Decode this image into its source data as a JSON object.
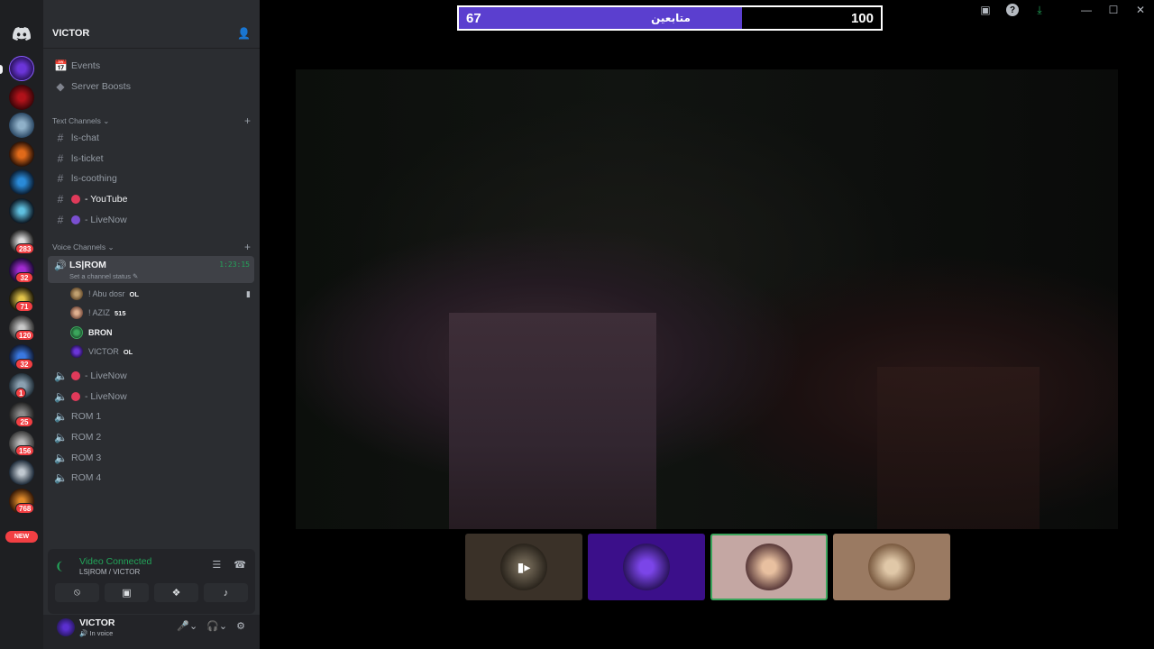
{
  "counter": {
    "current": "67",
    "label": "متابعين",
    "goal": "100",
    "progress": 0.67,
    "fill_color": "#5b3fcf"
  },
  "guild": {
    "name": "VICTOR"
  },
  "menu": {
    "events": "Events",
    "boosts": "Server Boosts"
  },
  "text_category": "Text Channels",
  "text_channels": [
    "ls-chat",
    "ls-ticket",
    "ls-coothing",
    "- YouTube",
    "- LiveNow"
  ],
  "voice_category": "Voice Channels",
  "active_voice": {
    "name": "LS|ROM",
    "status": "Set a channel status",
    "timer": "1:23:15"
  },
  "members": [
    {
      "name": "! Abu dosr",
      "tag": "OL"
    },
    {
      "name": "! AZIZ",
      "tag": "515"
    },
    {
      "name": "BRON",
      "tag": ""
    },
    {
      "name": "VICTOR",
      "tag": "OL"
    }
  ],
  "voice_channels": [
    "- LiveNow",
    "- LiveNow",
    "ROM 1",
    "ROM 2",
    "ROM 3",
    "ROM 4"
  ],
  "server_badges": [
    "283",
    "32",
    "71",
    "120",
    "32",
    "1",
    "25",
    "156",
    "768"
  ],
  "new_label": "NEW",
  "voice_panel": {
    "status": "Video Connected",
    "sub": "LS|ROM / VICTOR"
  },
  "user": {
    "name": "VICTOR",
    "status": "In voice"
  },
  "colors": {
    "accent": "#5865f2",
    "green": "#23a55a",
    "red": "#f23f43"
  }
}
